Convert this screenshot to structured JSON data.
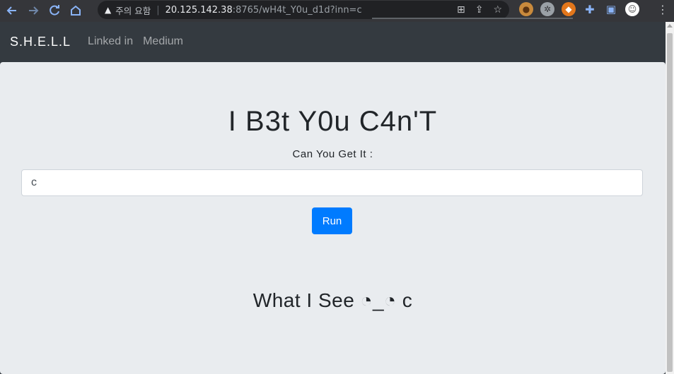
{
  "browser": {
    "url_warning": "주의 요함",
    "url_host": "20.125.142.38",
    "url_rest": ":8765/wH4t_Y0u_d1d?inn=c",
    "icons": [
      "back-icon",
      "forward-icon",
      "reload-icon",
      "home-icon",
      "translate-icon",
      "share-icon",
      "star-icon",
      "cookie-extension-icon",
      "extension-icon",
      "metamask-icon",
      "puzzle-icon",
      "sidepanel-icon",
      "profile-avatar",
      "menu-icon"
    ]
  },
  "navbar": {
    "brand": "S.H.E.L.L",
    "links": [
      "Linked in",
      "Medium"
    ]
  },
  "main": {
    "title": "I B3t Y0u C4n'T",
    "subtitle": "Can You Get It :",
    "input_value": "c",
    "run_label": "Run",
    "result": "What I See ◔_◔ c"
  },
  "colors": {
    "navbar_bg": "#343a40",
    "jumbotron_bg": "#e9ecef",
    "button_bg": "#007bff"
  }
}
